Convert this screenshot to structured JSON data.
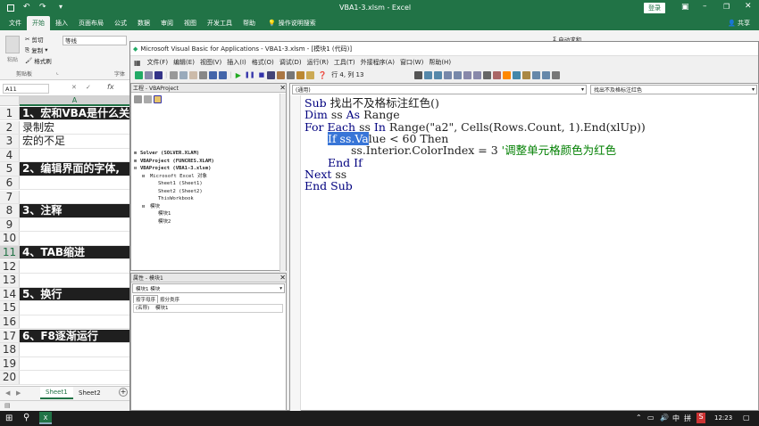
{
  "excel": {
    "window_title": "VBA1-3.xlsm - Excel",
    "login": "登录",
    "share": "共享",
    "tabs": [
      "文件",
      "开始",
      "插入",
      "页面布局",
      "公式",
      "数据",
      "审阅",
      "视图",
      "开发工具",
      "帮助"
    ],
    "tell_me": "操作说明搜索",
    "ribbon": {
      "cut": "剪切",
      "copy": "复制",
      "format_painter": "格式刷",
      "clipboard": "剪贴板",
      "font": "等线",
      "font_group": "字体",
      "autosum": "自动求和"
    },
    "name_box": "A11",
    "fx": "fx",
    "col_a": "A",
    "rows": [
      {
        "n": "1",
        "t": "1、宏和VBA是什么关",
        "dark": true
      },
      {
        "n": "2",
        "t": "录制宏",
        "dark": false
      },
      {
        "n": "3",
        "t": "宏的不足",
        "dark": false
      },
      {
        "n": "4",
        "t": "",
        "dark": false
      },
      {
        "n": "5",
        "t": "2、编辑界面的字体,",
        "dark": true
      },
      {
        "n": "6",
        "t": "",
        "dark": false
      },
      {
        "n": "7",
        "t": "",
        "dark": false
      },
      {
        "n": "8",
        "t": "3、注释",
        "dark": true
      },
      {
        "n": "9",
        "t": "",
        "dark": false
      },
      {
        "n": "10",
        "t": "",
        "dark": false
      },
      {
        "n": "11",
        "t": "4、TAB缩进",
        "dark": true
      },
      {
        "n": "12",
        "t": "",
        "dark": false
      },
      {
        "n": "13",
        "t": "",
        "dark": false
      },
      {
        "n": "14",
        "t": "5、换行",
        "dark": true
      },
      {
        "n": "15",
        "t": "",
        "dark": false
      },
      {
        "n": "16",
        "t": "",
        "dark": false
      },
      {
        "n": "17",
        "t": "6、F8逐渐运行",
        "dark": true
      },
      {
        "n": "18",
        "t": "",
        "dark": false
      },
      {
        "n": "19",
        "t": "",
        "dark": false
      },
      {
        "n": "20",
        "t": "",
        "dark": false
      }
    ],
    "sheets": [
      "Sheet1",
      "Sheet2"
    ]
  },
  "vbe": {
    "title": "Microsoft Visual Basic for Applications - VBA1-3.xlsm - [模块1 (代码)]",
    "menu": [
      "文件(F)",
      "编辑(E)",
      "视图(V)",
      "插入(I)",
      "格式(O)",
      "调试(D)",
      "运行(R)",
      "工具(T)",
      "外接程序(A)",
      "窗口(W)",
      "帮助(H)"
    ],
    "position": "行 4, 列 13",
    "project_title": "工程 - VBAProject",
    "tree": [
      "Solver (SOLVER.XLAM)",
      "VBAProject (FUNCRES.XLAM)",
      "VBAProject (VBA1-3.xlsm)",
      "Microsoft Excel 对象",
      "Sheet1 (Sheet1)",
      "Sheet2 (Sheet2)",
      "ThisWorkbook",
      "模块",
      "模块1",
      "模块2"
    ],
    "props_title": "属性 - 模块1",
    "props_object": "模块1 模块",
    "props_tabs": [
      "按字母序",
      "按分类序"
    ],
    "props_name_key": "(名称)",
    "props_name_val": "模块1",
    "combo_left": "(通用)",
    "combo_right": "找出不及格标注红色",
    "code": {
      "l1": "Sub 找出不及格标注红色()",
      "l2": "Dim ss As Range",
      "l3": "For Each ss In Range(\"a2\", Cells(Rows.Count, 1).End(xlUp))",
      "l4_sel": "If ss.Va",
      "l4_rest": "lue < 60 Then",
      "l5": "ss.Interior.ColorIndex = 3",
      "l5_comment": "'调整单元格颜色为红色",
      "l6": "End If",
      "l7": "Next ss",
      "l8": "End Sub"
    }
  },
  "taskbar": {
    "time": "12:23",
    "ime": "中",
    "ime2": "拼"
  }
}
